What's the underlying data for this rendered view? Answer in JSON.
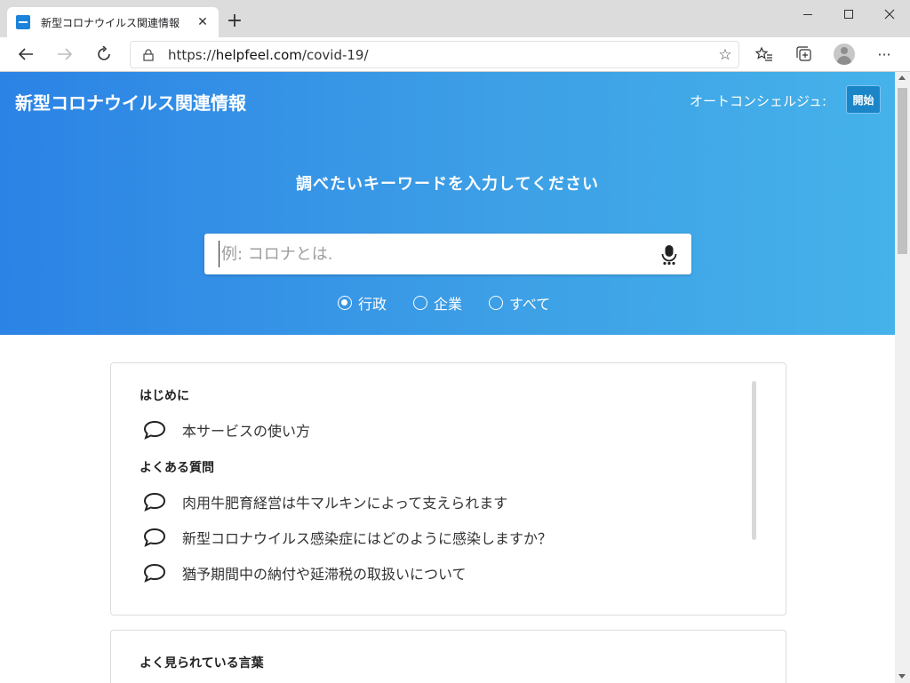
{
  "browser": {
    "tab_title": "新型コロナウイルス関連情報",
    "tab_close": "✕",
    "new_tab": "+",
    "url_prefix": "https://",
    "url_host": "helpfeel.com",
    "url_path": "/covid-19/"
  },
  "header": {
    "site_title": "新型コロナウイルス関連情報",
    "concierge_label": "オートコンシェルジュ:",
    "start_button": "開始"
  },
  "search": {
    "prompt": "調べたいキーワードを入力してください",
    "placeholder": "例: コロナとは.",
    "filters": [
      {
        "label": "行政",
        "selected": true
      },
      {
        "label": "企業",
        "selected": false
      },
      {
        "label": "すべて",
        "selected": false
      }
    ]
  },
  "sections": {
    "intro_heading": "はじめに",
    "intro_items": [
      "本サービスの使い方"
    ],
    "faq_heading": "よくある質問",
    "faq_items": [
      "肉用牛肥育経営は牛マルキンによって支えられます",
      "新型コロナウイルス感染症にはどのように感染しますか？",
      "猶予期間中の納付や延滞税の取扱いについて"
    ],
    "popular_heading": "よく見られている言葉"
  },
  "colors": {
    "hero_start": "#2b83e5",
    "hero_end": "#45b2ea",
    "start_button": "#1a86c8"
  }
}
